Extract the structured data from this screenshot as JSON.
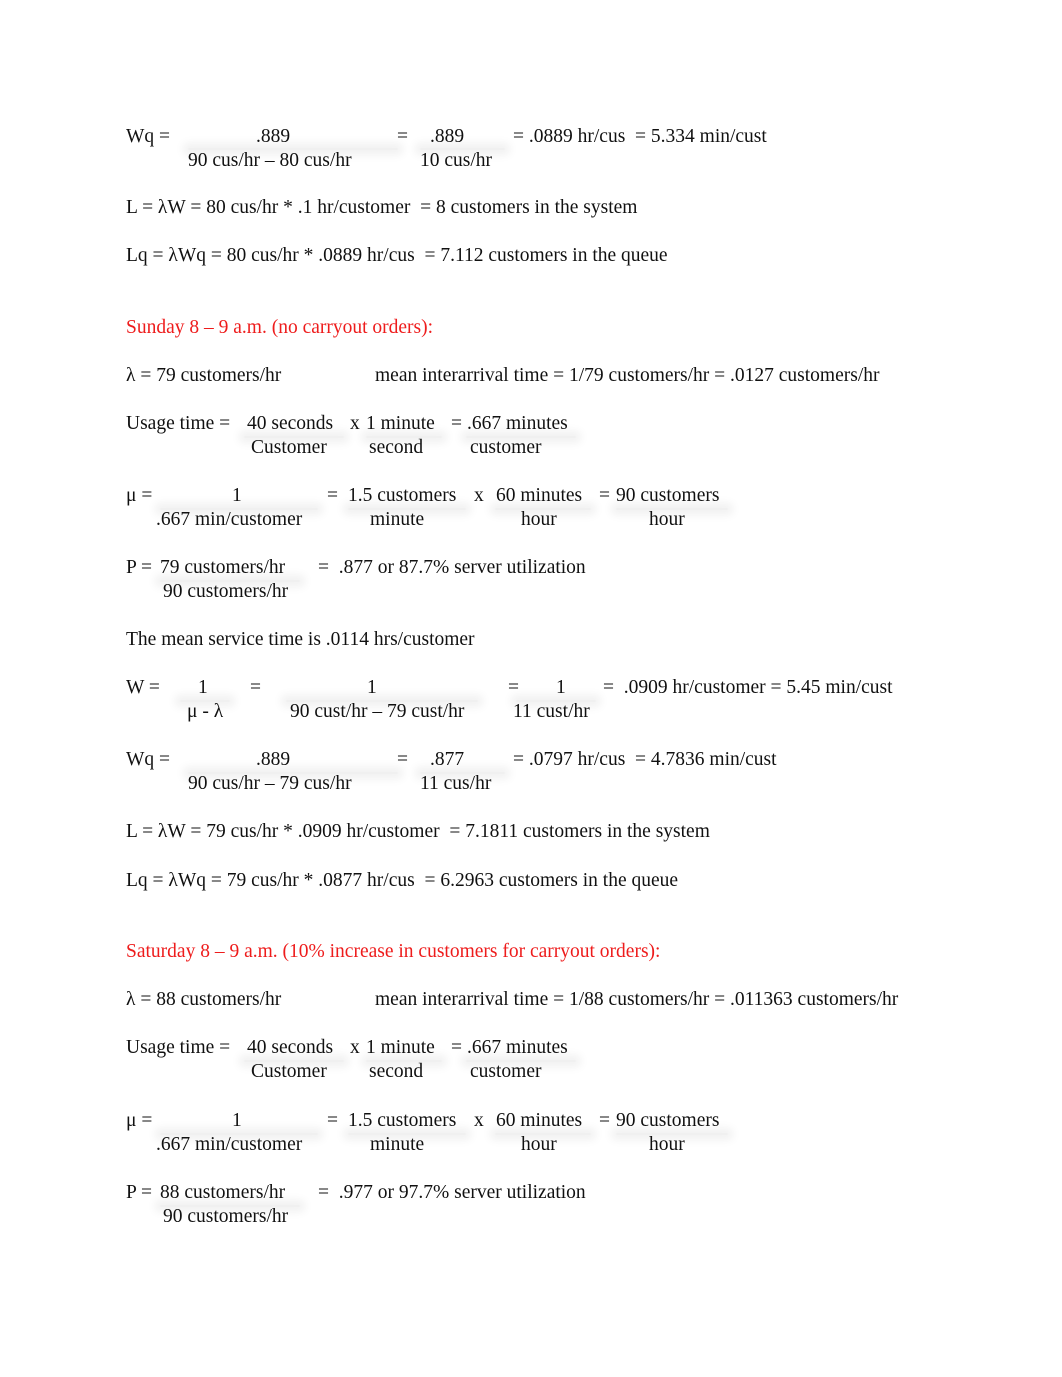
{
  "document": {
    "section_weekday_tail": {
      "wq": {
        "label": "Wq =",
        "num1": ".889",
        "den1": "90 cus/hr – 80 cus/hr",
        "eq1": "=",
        "num2": ".889",
        "den2": "10 cus/hr",
        "result": "= .0889 hr/cus  = 5.334 min/cust"
      },
      "l_line": "L = λW = 80 cus/hr * .1 hr/customer  = 8 customers in the system",
      "lq_line": "Lq = λWq = 80 cus/hr * .0889 hr/cus  = 7.112 customers in the queue"
    },
    "sunday": {
      "heading": "Sunday 8 – 9 a.m. (no carryout orders):",
      "lambda": "λ = 79 customers/hr",
      "interarrival": "mean interarrival time = 1/79 customers/hr = .0127 customers/hr",
      "usage": {
        "label": "Usage time =",
        "num1": "40 seconds",
        "den1": "Customer",
        "x": "x",
        "num2": "1 minute",
        "den2": "second",
        "eq": "=",
        "num3": ".667 minutes",
        "den3": "customer"
      },
      "mu": {
        "label": "μ =",
        "num1": "1",
        "den1": ".667 min/customer",
        "eq1": "=",
        "num2": "1.5 customers",
        "den2": "minute",
        "x": "x",
        "num3": "60 minutes",
        "den3": "hour",
        "eq2": "=",
        "num4": "90 customers",
        "den4": "hour"
      },
      "p": {
        "label": "P =",
        "num": "79 customers/hr",
        "den": "90 customers/hr",
        "result": "=  .877 or 87.7% server utilization"
      },
      "mean_service": "The mean service time is .0114 hrs/customer",
      "w": {
        "label": "W =",
        "num1": "1",
        "den1": "μ - λ",
        "eq1": "=",
        "num2": "1",
        "den2": "90 cust/hr – 79 cust/hr",
        "eq2": "=",
        "num3": "1",
        "den3": "11 cust/hr",
        "result": "=  .0909 hr/customer = 5.45 min/cust"
      },
      "wq": {
        "label": "Wq =",
        "num1": ".889",
        "den1": "90 cus/hr – 79 cus/hr",
        "eq1": "=",
        "num2": ".877",
        "den2": "11 cus/hr",
        "result": "= .0797 hr/cus  = 4.7836 min/cust"
      },
      "l_line": "L = λW = 79 cus/hr * .0909 hr/customer  = 7.1811 customers in the system",
      "lq_line": "Lq = λWq = 79 cus/hr * .0877 hr/cus  = 6.2963 customers in the queue"
    },
    "saturday": {
      "heading": "Saturday 8 – 9 a.m. (10% increase in customers for carryout orders):",
      "lambda": "λ = 88 customers/hr",
      "interarrival": "mean interarrival time = 1/88 customers/hr = .011363 customers/hr",
      "usage": {
        "label": "Usage time =",
        "num1": "40 seconds",
        "den1": "Customer",
        "x": "x",
        "num2": "1 minute",
        "den2": "second",
        "eq": "=",
        "num3": ".667 minutes",
        "den3": "customer"
      },
      "mu": {
        "label": "μ =",
        "num1": "1",
        "den1": ".667 min/customer",
        "eq1": "=",
        "num2": "1.5 customers",
        "den2": "minute",
        "x": "x",
        "num3": "60 minutes",
        "den3": "hour",
        "eq2": "=",
        "num4": "90 customers",
        "den4": "hour"
      },
      "p": {
        "label": "P =",
        "num": "88 customers/hr",
        "den": "90 customers/hr",
        "result": "=  .977 or 97.7% server utilization"
      }
    }
  }
}
